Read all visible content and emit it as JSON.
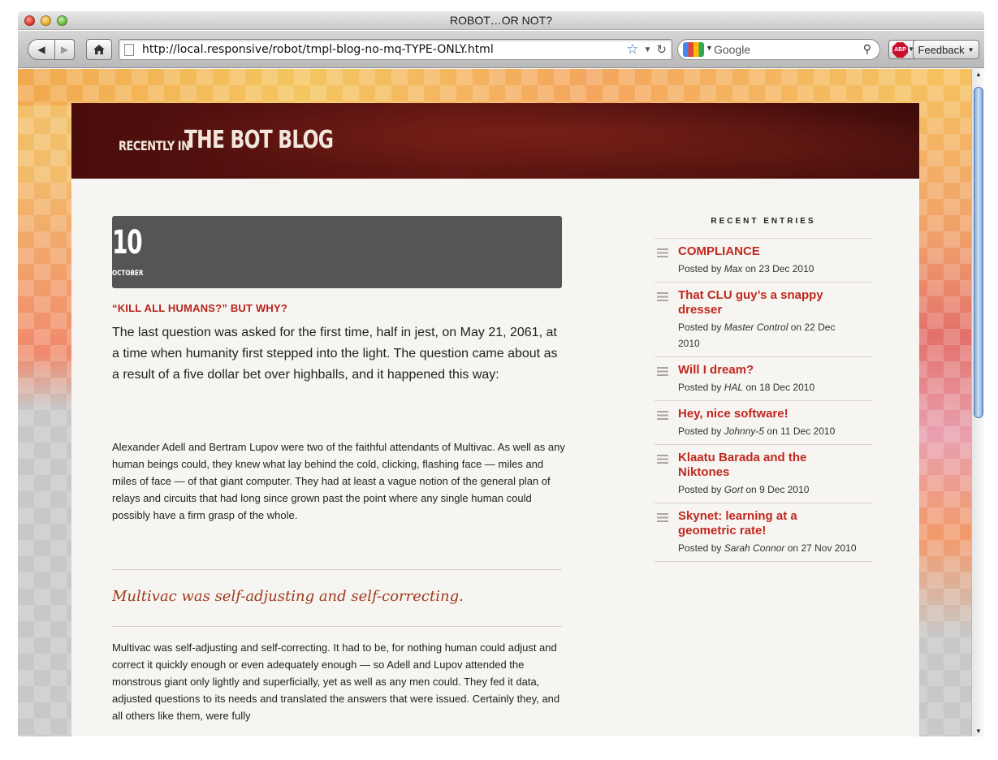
{
  "window": {
    "title": "ROBOT…OR NOT?"
  },
  "toolbar": {
    "url": "http://local.responsive/robot/tmpl-blog-no-mq-TYPE-ONLY.html",
    "search_placeholder": "Google",
    "feedback_label": "Feedback",
    "abp_label": "ABP"
  },
  "banner": {
    "prefix": "RECENTLY IN",
    "title": "THE BOT BLOG"
  },
  "post": {
    "day": "10",
    "month": "OCTOBER",
    "title": "“KILL ALL HUMANS?” BUT WHY?",
    "lead": "The last question was asked for the first time, half in jest, on May 21, 2061, at a time when humanity first stepped into the light. The question came about as a result of a five dollar bet over highballs, and it happened this way:",
    "paragraph1": "Alexander Adell and Bertram Lupov were two of the faithful attendants of Multivac. As well as any human beings could, they knew what lay behind the cold, clicking, flashing face — miles and miles of face — of that giant computer. They had at least a vague notion of the general plan of relays and circuits that had long since grown past the point where any single human could possibly have a firm grasp of the whole.",
    "pullquote": "Multivac was self-adjusting and self-correcting.",
    "paragraph2": "Multivac was self-adjusting and self-correcting. It had to be, for nothing human could adjust and correct it quickly enough or even adequately enough — so Adell and Lupov attended the monstrous giant only lightly and superficially, yet as well as any men could. They fed it data, adjusted questions to its needs and translated the answers that were issued. Certainly they, and all others like them, were fully"
  },
  "sidebar": {
    "heading": "RECENT ENTRIES",
    "entries": [
      {
        "title": "COMPLIANCE",
        "prefix": "Posted by ",
        "author": "Max",
        "suffix": " on 23 Dec 2010"
      },
      {
        "title": "That CLU guy’s a snappy dresser",
        "prefix": "Posted by ",
        "author": "Master Control",
        "suffix": " on 22 Dec 2010"
      },
      {
        "title": "Will I dream?",
        "prefix": "Posted by ",
        "author": "HAL",
        "suffix": " on 18 Dec 2010"
      },
      {
        "title": "Hey, nice software!",
        "prefix": "Posted by ",
        "author": "Johnny-5",
        "suffix": " on 11 Dec 2010"
      },
      {
        "title": "Klaatu Barada and the Niktones",
        "prefix": "Posted by ",
        "author": "Gort",
        "suffix": " on 9 Dec 2010"
      },
      {
        "title": "Skynet: learning at a geometric rate!",
        "prefix": "Posted by ",
        "author": "Sarah Connor",
        "suffix": " on 27 Nov 2010"
      }
    ]
  }
}
